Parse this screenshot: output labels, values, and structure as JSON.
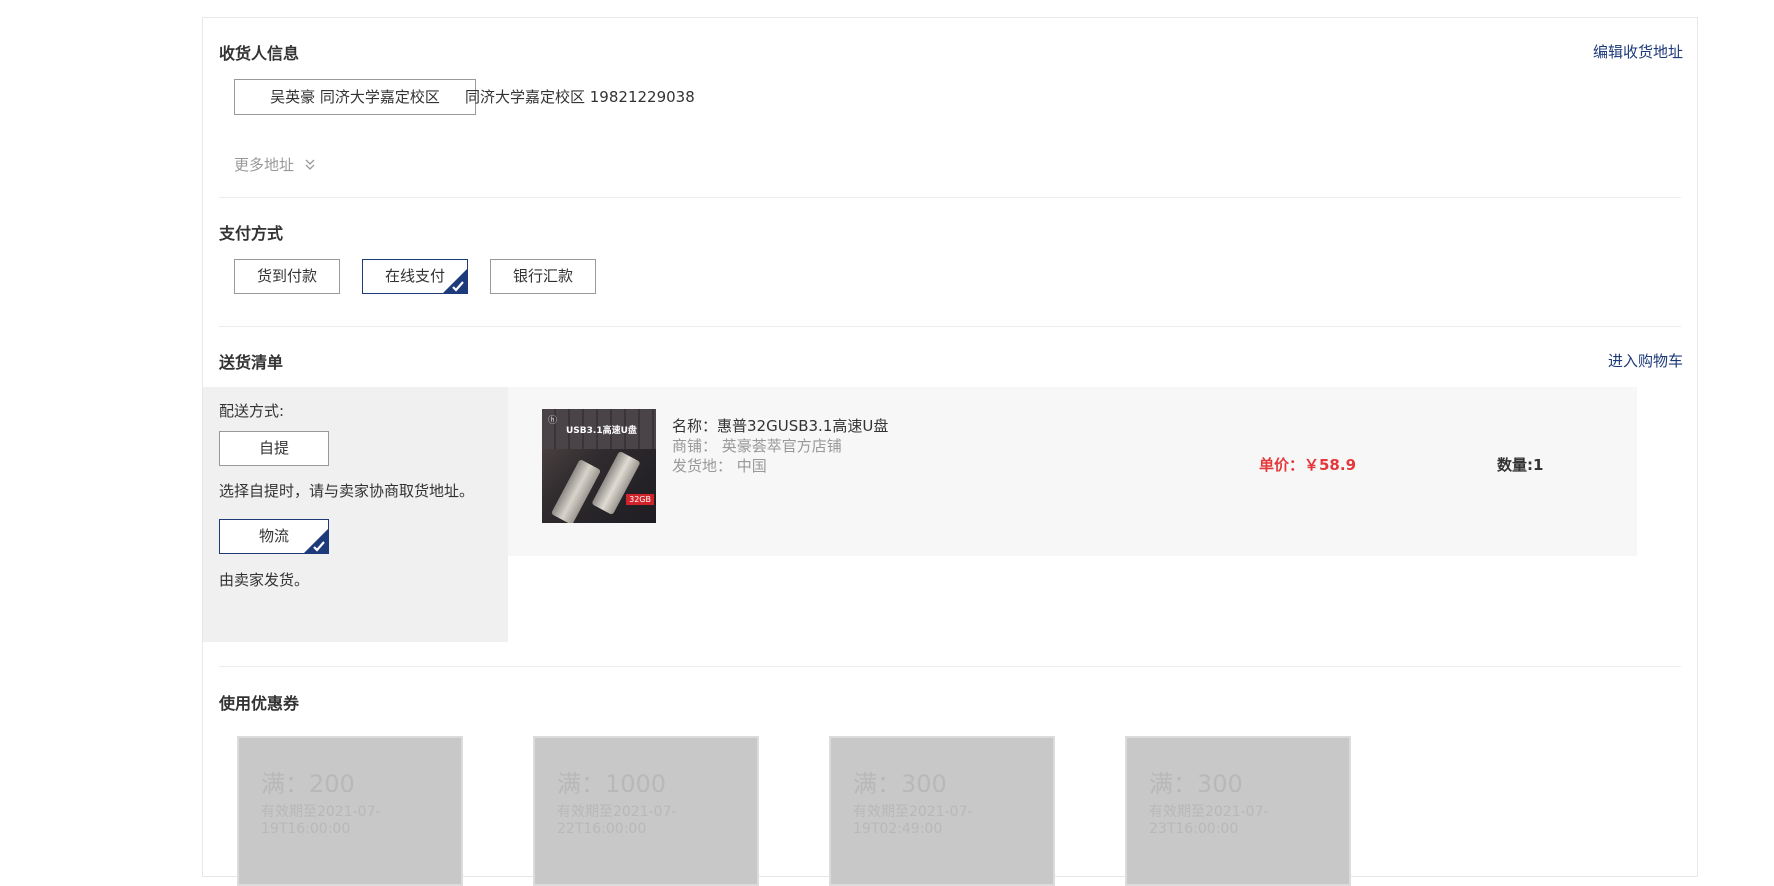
{
  "receiver": {
    "title": "收货人信息",
    "edit_link": "编辑收货地址",
    "selected_address_label": "吴英豪 同济大学嘉定校区",
    "address_detail": "同济大学嘉定校区 19821229038",
    "more_addresses": "更多地址",
    "more_icon": "double-chevron-down-icon"
  },
  "payment": {
    "title": "支付方式",
    "options": [
      "货到付款",
      "在线支付",
      "银行汇款"
    ],
    "selected": "在线支付"
  },
  "shipping": {
    "title": "送货清单",
    "cart_link": "进入购物车",
    "method_label": "配送方式:",
    "methods": [
      {
        "label": "自提",
        "note": "选择自提时，请与卖家协商取货地址。"
      },
      {
        "label": "物流",
        "note": "由卖家发货。"
      }
    ],
    "selected_method": "物流",
    "item": {
      "name": "名称：惠普32GUSB3.1高速U盘",
      "shop": "商铺： 英豪荟萃官方店铺",
      "origin": "发货地： 中国",
      "image_text": "USB3.1高速U盘",
      "image_capacity": "32GB",
      "price": "单价：￥58.9",
      "quantity": "数量:1"
    }
  },
  "coupons": {
    "title": "使用优惠券",
    "items": [
      {
        "amount": "满：200",
        "valid": "有效期至2021-07-19T16:00:00"
      },
      {
        "amount": "满：1000",
        "valid": "有效期至2021-07-22T16:00:00"
      },
      {
        "amount": "满：300",
        "valid": "有效期至2021-07-19T02:49:00"
      },
      {
        "amount": "满：300",
        "valid": "有效期至2021-07-23T16:00:00"
      }
    ]
  },
  "colors": {
    "accent": "#1d3a7a",
    "price": "#e4393c",
    "coupon_bg": "#c8c8c8"
  }
}
